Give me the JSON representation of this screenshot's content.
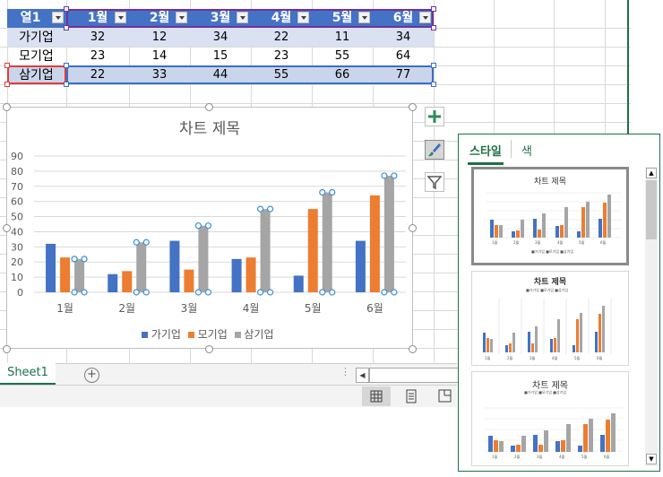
{
  "table": {
    "headers": [
      "열1",
      "1월",
      "2월",
      "3월",
      "4월",
      "5월",
      "6월"
    ],
    "rows": [
      {
        "label": "가기업",
        "values": [
          "32",
          "12",
          "34",
          "22",
          "11",
          "34"
        ]
      },
      {
        "label": "모기업",
        "values": [
          "23",
          "14",
          "15",
          "23",
          "55",
          "64"
        ]
      },
      {
        "label": "삼기업",
        "values": [
          "22",
          "33",
          "44",
          "55",
          "66",
          "77"
        ]
      }
    ]
  },
  "chart_data": {
    "type": "bar",
    "title": "차트 제목",
    "categories": [
      "1월",
      "2월",
      "3월",
      "4월",
      "5월",
      "6월"
    ],
    "series": [
      {
        "name": "가기업",
        "values": [
          32,
          12,
          34,
          22,
          11,
          34
        ],
        "color": "#4472c4"
      },
      {
        "name": "모기업",
        "values": [
          23,
          14,
          15,
          23,
          55,
          64
        ],
        "color": "#ed7d31"
      },
      {
        "name": "삼기업",
        "values": [
          22,
          33,
          44,
          55,
          66,
          77
        ],
        "color": "#a5a5a5"
      }
    ],
    "ylim": [
      0,
      90
    ],
    "yticks": [
      "0",
      "10",
      "20",
      "30",
      "40",
      "50",
      "60",
      "70",
      "80",
      "90"
    ],
    "grid": true,
    "legend": "bottom"
  },
  "sheet_tab": "Sheet1",
  "pane": {
    "tab_style": "스타일",
    "tab_color": "색",
    "thumb1_title": "차트 제목",
    "thumb2_title": "차트 제목",
    "thumb3_title": "차트 제목"
  },
  "colors": {
    "accent": "#1e7145",
    "header": "#4472c4"
  }
}
